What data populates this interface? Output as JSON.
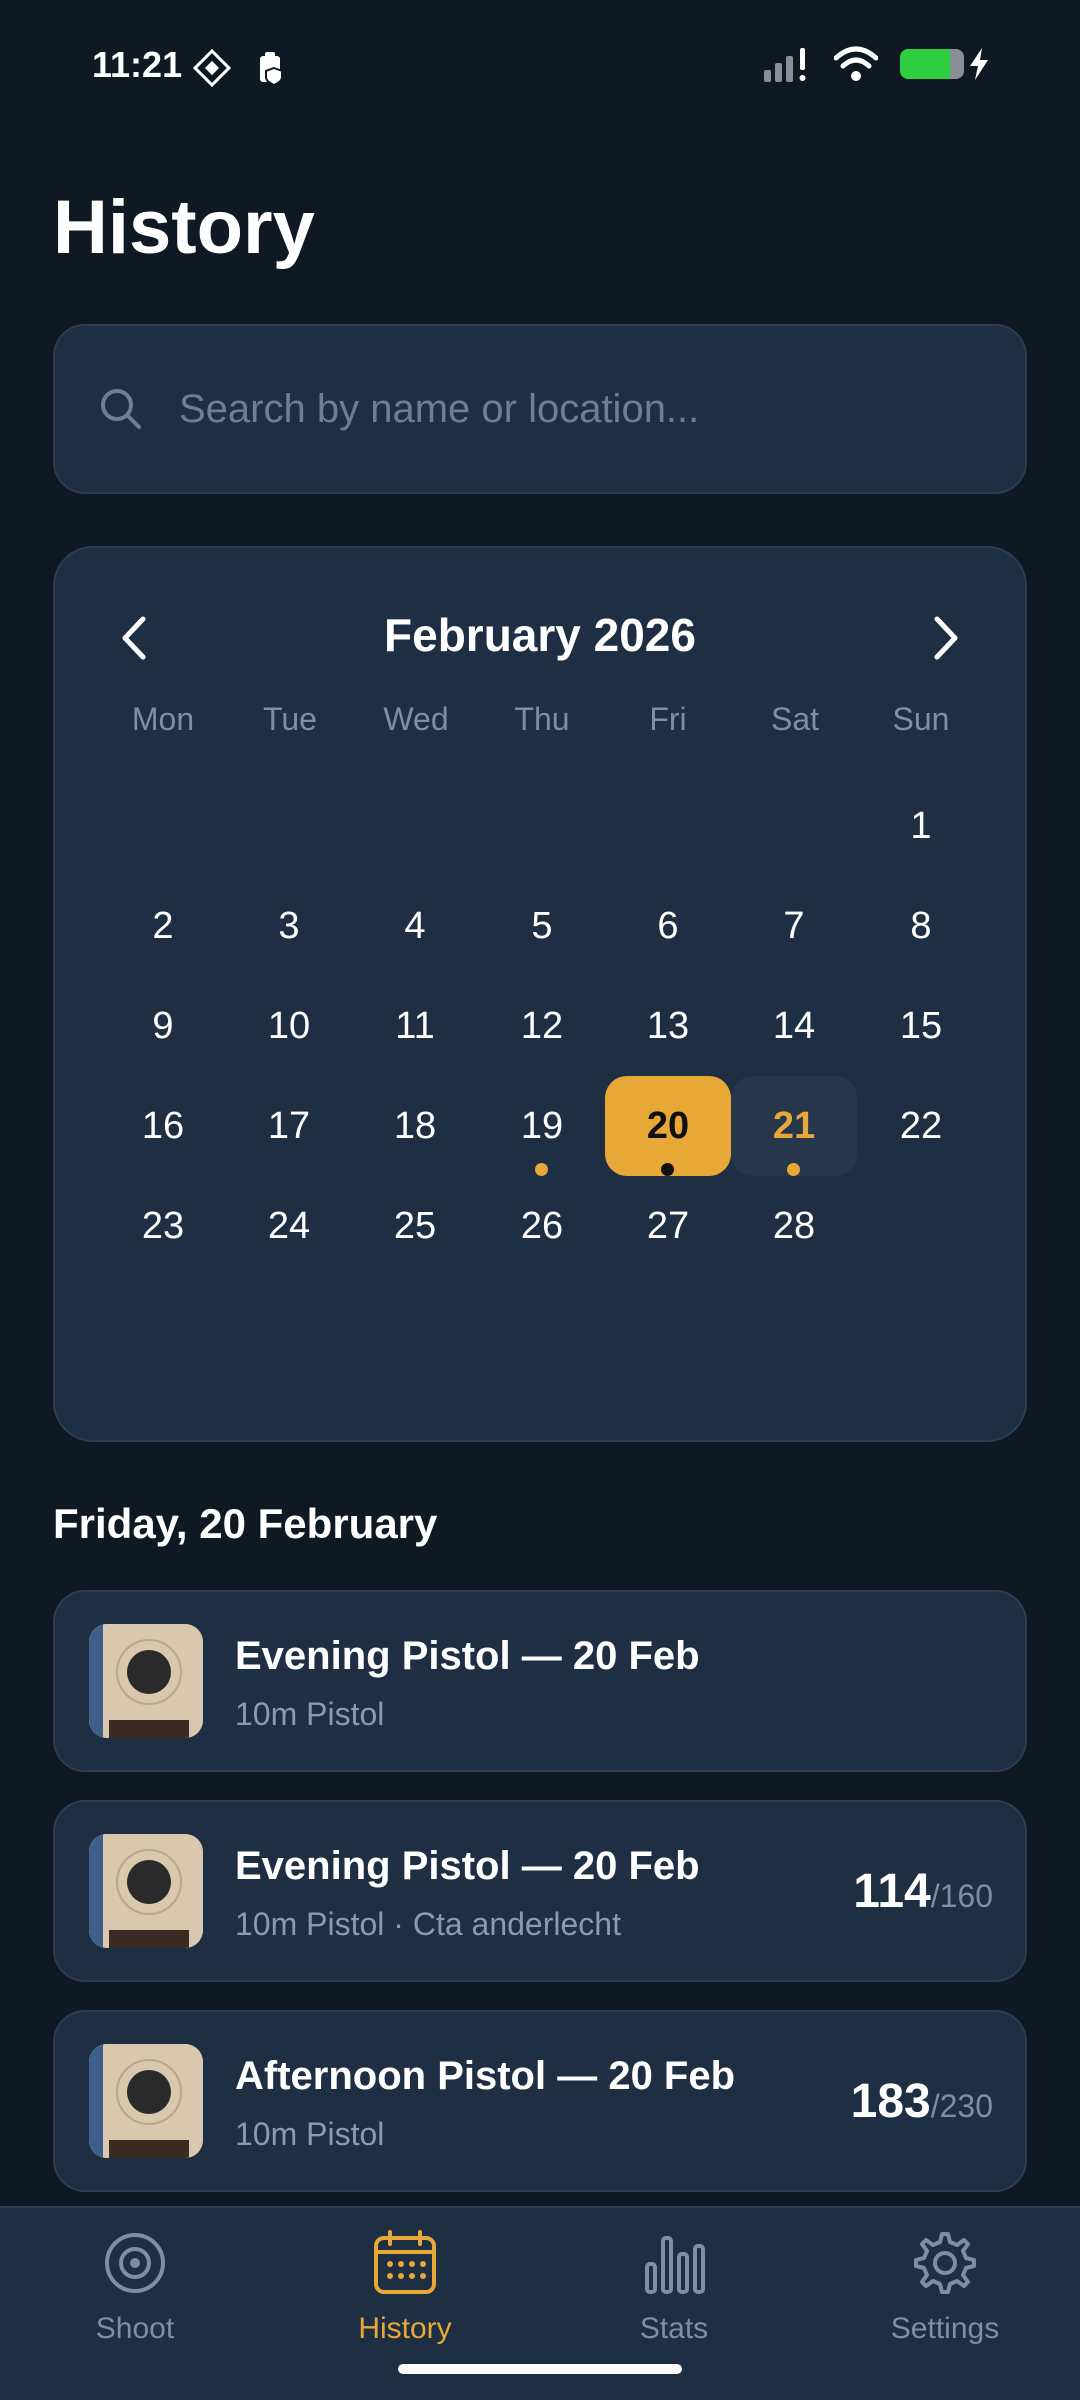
{
  "status": {
    "time": "11:21"
  },
  "title": "History",
  "search": {
    "placeholder": "Search by name or location..."
  },
  "calendar": {
    "month_label": "February 2026",
    "weekdays": [
      "Mon",
      "Tue",
      "Wed",
      "Thu",
      "Fri",
      "Sat",
      "Sun"
    ],
    "days": [
      "1",
      "2",
      "3",
      "4",
      "5",
      "6",
      "7",
      "8",
      "9",
      "10",
      "11",
      "12",
      "13",
      "14",
      "15",
      "16",
      "17",
      "18",
      "19",
      "20",
      "21",
      "22",
      "23",
      "24",
      "25",
      "26",
      "27",
      "28"
    ],
    "selected_day": "20",
    "today_day": "21",
    "days_with_sessions": [
      "19",
      "20",
      "21"
    ]
  },
  "section_title": "Friday, 20 February",
  "sessions": [
    {
      "name": "Evening Pistol — 20 Feb",
      "meta": "10m Pistol",
      "score": "",
      "max": ""
    },
    {
      "name": "Evening Pistol — 20 Feb",
      "meta": "10m Pistol · Cta anderlecht",
      "score": "114",
      "max": "/160"
    },
    {
      "name": "Afternoon Pistol — 20 Feb",
      "meta": "10m Pistol",
      "score": "183",
      "max": "/230"
    }
  ],
  "nav": {
    "items": [
      {
        "label": "Shoot",
        "icon": "target-icon"
      },
      {
        "label": "History",
        "icon": "calendar-icon"
      },
      {
        "label": "Stats",
        "icon": "bar-chart-icon"
      },
      {
        "label": "Settings",
        "icon": "gear-icon"
      }
    ],
    "active": "History"
  },
  "colors": {
    "accent": "#e8a838",
    "background": "#0f1923",
    "card": "#1e2f44"
  }
}
